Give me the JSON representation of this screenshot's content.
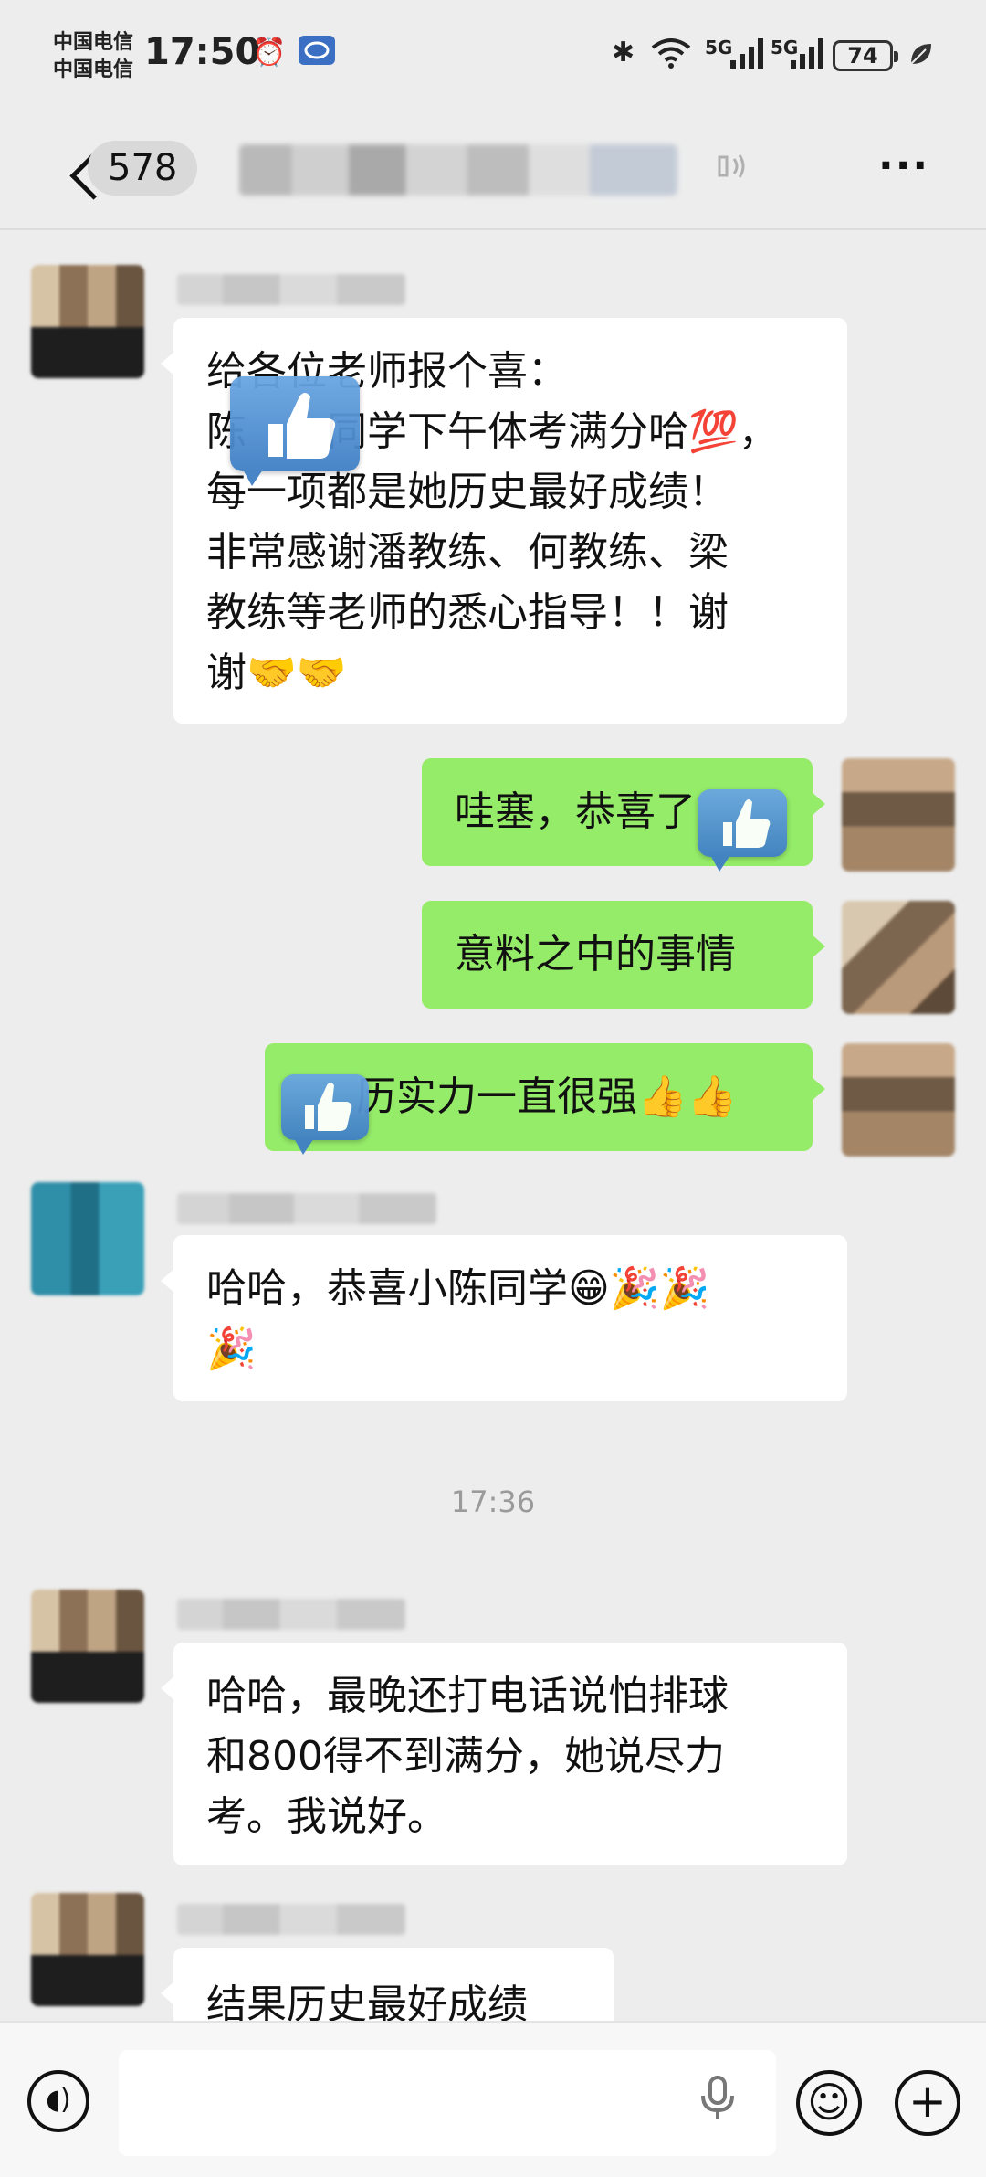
{
  "status_bar": {
    "carrier_1": "中国电信",
    "carrier_2": "中国电信",
    "time": "17:50",
    "alarm_icon": "alarm-icon",
    "bluetooth_icon": "✱",
    "wifi_icon": "wifi-icon",
    "signal_1": "5G",
    "signal_2": "5G",
    "battery": "74"
  },
  "header": {
    "back_icon": "chevron-left-icon",
    "unread_count": "578",
    "more_label": "···"
  },
  "messages": [
    {
      "side": "left",
      "lines": [
        "给各位老师报个喜：",
        "陈　　同学下午体考满分哈💯，",
        "每一项都是她历史最好成绩！",
        "非常感谢潘教练、何教练、梁",
        "教练等老师的悉心指导！！谢",
        "谢🤝🤝"
      ]
    },
    {
      "side": "right",
      "text": "哇塞，恭喜了"
    },
    {
      "side": "right",
      "text": "意料之中的事情"
    },
    {
      "side": "right",
      "text": "历实力一直很强👍👍"
    },
    {
      "side": "left",
      "lines": [
        "哈哈，恭喜小陈同学😁🎉🎉",
        "🎉"
      ]
    },
    {
      "side": "left",
      "lines": [
        "哈哈，最晚还打电话说怕排球",
        "和800得不到满分，她说尽力",
        "考。我说好。"
      ]
    },
    {
      "side": "left",
      "lines": [
        "结果历史最好成绩"
      ]
    }
  ],
  "timestamp": "17:36",
  "input_bar": {
    "voice_icon": "voice-icon",
    "mic_icon": "microphone-icon",
    "emoji_icon": "emoji-icon",
    "plus_icon": "plus-icon",
    "voice_glyph": "◖)",
    "mic_glyph": "🎙",
    "emoji_glyph": "☺",
    "plus_glyph": "+",
    "input_value": ""
  }
}
